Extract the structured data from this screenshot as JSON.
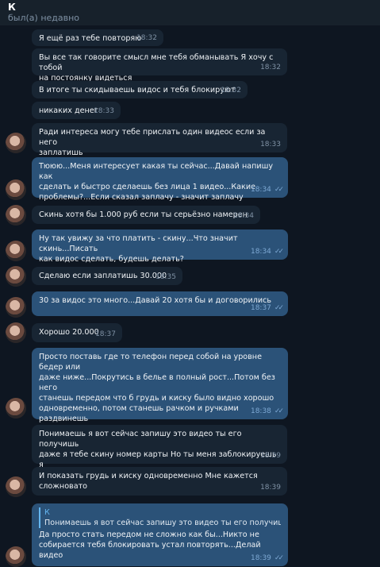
{
  "header": {
    "contact_name": "К",
    "status": "был(а) недавно"
  },
  "messages": [
    {
      "dir": "in",
      "text": "Я ещё раз тебе повторяю",
      "time": "18:32"
    },
    {
      "dir": "in",
      "text": "Вы все так говорите смысл мне тебя обманывать Я хочу с тобой\nна постоянку видеться",
      "time": "18:32"
    },
    {
      "dir": "in",
      "text": "В итоге ты скидываешь видос и тебя блокируют",
      "time": "18:32"
    },
    {
      "dir": "in",
      "text": "никаких денег",
      "time": "18:33"
    },
    {
      "dir": "in",
      "text": "Ради интереса могу тебе прислать один видеос если за него\nзаплатишь",
      "time": "18:33"
    },
    {
      "dir": "out",
      "text": "Тююю...Меня интересует какая ты сейчас...Давай напишу как\nсделать и быстро сделаешь без лица 1 видео...Какие\nпроблемы?...Если сказал заплачу - значит заплачу",
      "time": "18:34"
    },
    {
      "dir": "in",
      "text": "Скинь хотя бы 1.000 руб если ты серьёзно намерен",
      "time": "18:34"
    },
    {
      "dir": "out",
      "text": "Ну так увижу за что платить - скину...Что значит скинь...Писать\nкак видос сделать, будешь делать?",
      "time": "18:34"
    },
    {
      "dir": "in",
      "text": "Сделаю если заплатишь 30.000",
      "time": "18:35"
    },
    {
      "dir": "out",
      "text": "30 за видос это много...Давай 20 хотя бы и договорились",
      "time": "18:37"
    },
    {
      "dir": "in",
      "text": "Хорошо 20.000",
      "time": "18:37"
    },
    {
      "dir": "out",
      "text": "Просто поставь где то телефон перед собой на уровне бедер или\nдаже ниже...Покрутись в белье в полный рост...Потом без него\nстанешь передом что б грудь и киску было видно хорошо\nодновременно, потом станешь рачком и ручками раздвинешь\nпопу...И с видео напишешь номер для перевода...Делай...Жду",
      "time": "18:38"
    },
    {
      "dir": "in",
      "text": "Понимаешь я вот сейчас запишу это видео ты его получишь\nдаже я тебе скину номер карты Но ты меня заблокируешь я\nболее чем уверена",
      "time": "18:39"
    },
    {
      "dir": "in",
      "text": "И показать грудь и киску одновременно Мне кажется\nсложновато",
      "time": "18:39"
    },
    {
      "dir": "out",
      "quote_name": "К",
      "quote_text": "Понимаешь я вот сейчас запишу это видео ты его получишь...",
      "text": "Да просто стать передом не сложно как бы...Никто не\nсобирается тебя блокировать устал повторять...Делай видео",
      "time": "18:39"
    }
  ],
  "colors": {
    "background": "#0e1621",
    "incoming": "#182533",
    "outgoing": "#2b5278",
    "accent": "#64b5ef"
  },
  "icons": {
    "read_receipt": "double-check-icon"
  }
}
